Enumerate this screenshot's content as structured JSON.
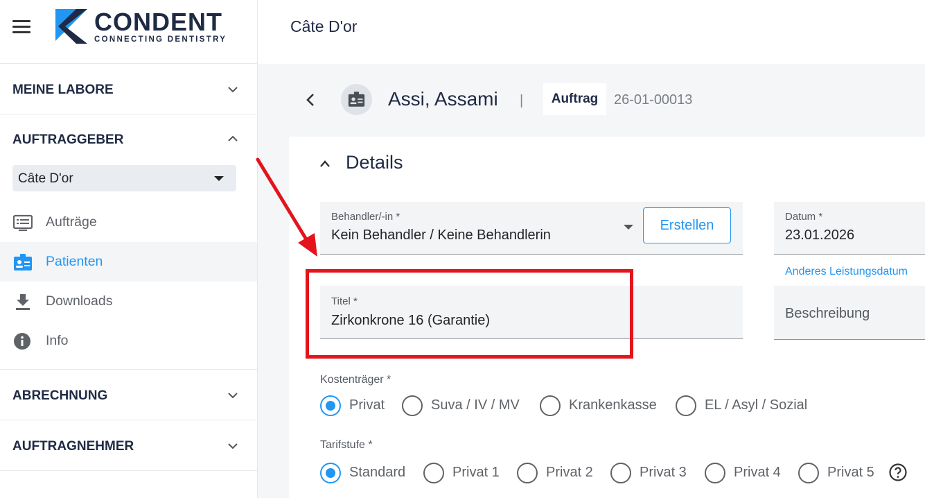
{
  "app": {
    "brand": "CONDENT",
    "tagline": "CONNECTING DENTISTRY",
    "accent": "#2196f3",
    "brand_color": "#1f2a44"
  },
  "sidebar": {
    "sections": {
      "labs": "MEINE LABORE",
      "clients": "AUFTRAGGEBER",
      "billing": "ABRECHNUNG",
      "contractors": "AUFTRAGNEHMER"
    },
    "client_select": "Câte D'or",
    "items": [
      {
        "label": "Aufträge",
        "icon": "list-icon"
      },
      {
        "label": "Patienten",
        "icon": "patient-badge-icon",
        "active": true
      },
      {
        "label": "Downloads",
        "icon": "download-icon"
      },
      {
        "label": "Info",
        "icon": "info-icon"
      }
    ]
  },
  "header": {
    "title": "Câte D'or"
  },
  "patient": {
    "name": "Assi, Assami",
    "separator": "|",
    "badge": "Auftrag",
    "order_number": "26-01-00013"
  },
  "details": {
    "heading": "Details",
    "behandler": {
      "label": "Behandler/-in *",
      "value": "Kein Behandler / Keine Behandlerin"
    },
    "create_button": "Erstellen",
    "datum": {
      "label": "Datum *",
      "value": "23.01.2026"
    },
    "other_date_link": "Anderes Leistungsdatum",
    "titel": {
      "label": "Titel *",
      "value": "Zirkonkrone 16 (Garantie)"
    },
    "beschreibung_placeholder": "Beschreibung",
    "kostentraeger": {
      "label": "Kostenträger *",
      "options": [
        "Privat",
        "Suva / IV / MV",
        "Krankenkasse",
        "EL / Asyl / Sozial"
      ],
      "selected": "Privat"
    },
    "tarifstufe": {
      "label": "Tarifstufe *",
      "options": [
        "Standard",
        "Privat 1",
        "Privat 2",
        "Privat 3",
        "Privat 4",
        "Privat 5"
      ],
      "selected": "Standard"
    }
  },
  "annotation": {
    "color": "#e3141b"
  }
}
